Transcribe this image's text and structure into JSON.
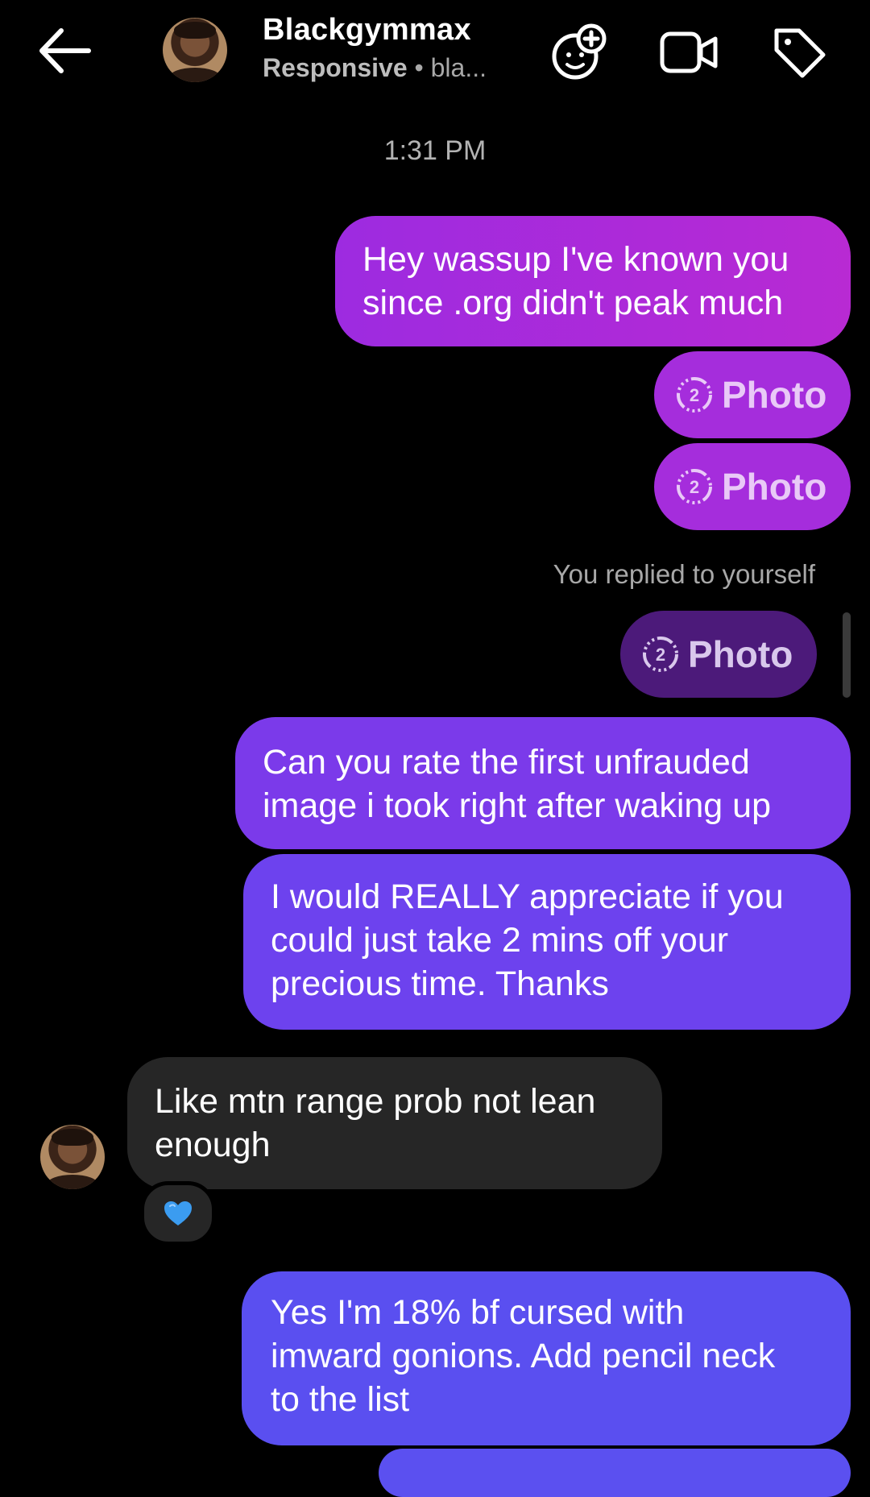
{
  "header": {
    "contact_name": "Blackgymmax",
    "status": "Responsive",
    "status_detail": "bla..."
  },
  "thread": {
    "timestamp": "1:31 PM",
    "message_1": "Hey wassup I've known you\nsince .org didn't peak much",
    "photo_label": "Photo",
    "replied_note": "You replied to yourself",
    "message_2": "Can you rate the first unfrauded\nimage i took right after waking up",
    "message_3": "I would REALLY appreciate if you\ncould just take 2 mins off your\nprecious time. Thanks",
    "incoming_1": "Like mtn range prob not lean\nenough",
    "reaction_emoji": "💙",
    "message_4": "Yes I'm 18% bf cursed with\nimward gonions. Add pencil neck\nto the list"
  },
  "colors": {
    "background": "#000000",
    "outgoing_top": "#b82ad3",
    "outgoing_mid": "#7b3aea",
    "outgoing_bottom": "#5a4ff0",
    "incoming": "#262626"
  }
}
